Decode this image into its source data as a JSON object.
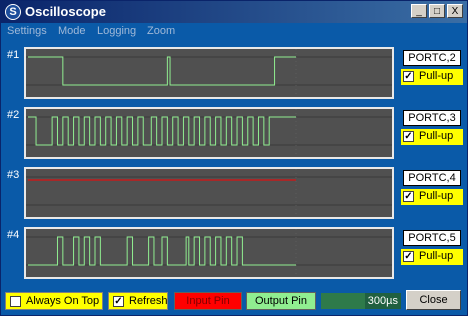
{
  "window": {
    "title": "Oscilloscope",
    "app_icon": "S"
  },
  "titlebar_buttons": {
    "minimize": "_",
    "maximize": "□",
    "close": "X"
  },
  "menu": [
    "Settings",
    "Mode",
    "Logging",
    "Zoom"
  ],
  "colors": {
    "trace": "#90ee90",
    "input_trace": "#ff0000",
    "scope_bg": "#505050",
    "accent_blue": "#0a5aa8"
  },
  "channels": [
    {
      "label": "#1",
      "port": "PORTC,2",
      "pullup_label": "Pull-up",
      "pullup_checked": true,
      "mode": "output",
      "transitions": [
        0,
        1,
        0.13,
        0,
        0.52,
        1,
        0.53,
        0,
        0.92,
        1
      ]
    },
    {
      "label": "#2",
      "port": "PORTC,3",
      "pullup_label": "Pull-up",
      "pullup_checked": true,
      "mode": "output",
      "transitions": [
        0,
        1,
        0.03,
        0,
        0.09,
        1,
        0.11,
        0,
        0.13,
        1,
        0.15,
        0,
        0.17,
        1,
        0.19,
        0,
        0.21,
        1,
        0.23,
        0,
        0.25,
        1,
        0.27,
        0,
        0.29,
        1,
        0.31,
        0,
        0.33,
        1,
        0.35,
        0,
        0.37,
        1,
        0.39,
        0,
        0.41,
        1,
        0.43,
        0,
        0.46,
        1,
        0.48,
        0,
        0.5,
        1,
        0.52,
        0,
        0.54,
        1,
        0.56,
        0,
        0.58,
        1,
        0.6,
        0,
        0.62,
        1,
        0.64,
        0,
        0.66,
        1,
        0.68,
        0,
        0.7,
        1,
        0.72,
        0,
        0.74,
        1,
        0.76,
        0,
        0.78,
        1,
        0.8,
        0,
        0.82,
        1,
        0.84,
        0,
        0.86,
        1,
        0.88,
        0,
        0.9,
        1
      ]
    },
    {
      "label": "#3",
      "port": "PORTC,4",
      "pullup_label": "Pull-up",
      "pullup_checked": true,
      "mode": "input",
      "transitions": [
        0,
        1
      ]
    },
    {
      "label": "#4",
      "port": "PORTC,5",
      "pullup_label": "Pull-up",
      "pullup_checked": true,
      "mode": "output",
      "transitions": [
        0,
        0,
        0.11,
        1,
        0.13,
        0,
        0.17,
        1,
        0.19,
        0,
        0.21,
        1,
        0.23,
        0,
        0.25,
        1,
        0.27,
        0,
        0.37,
        1,
        0.39,
        0,
        0.45,
        1,
        0.47,
        0,
        0.5,
        1,
        0.52,
        0,
        0.59,
        1,
        0.6,
        0,
        0.62,
        1,
        0.64,
        0,
        0.66,
        1,
        0.68,
        0,
        0.7,
        1,
        0.72,
        0,
        0.74,
        1,
        0.76,
        0,
        0.78,
        1,
        0.8,
        0
      ]
    }
  ],
  "bottom": {
    "always_on_top": {
      "label": "Always On Top",
      "checked": false
    },
    "refresh": {
      "label": "Refresh",
      "checked": true
    },
    "legend_input": "Input Pin",
    "legend_output": "Output Pin",
    "timebase": "300µs",
    "progress_fraction": 0.55,
    "close": "Close"
  }
}
